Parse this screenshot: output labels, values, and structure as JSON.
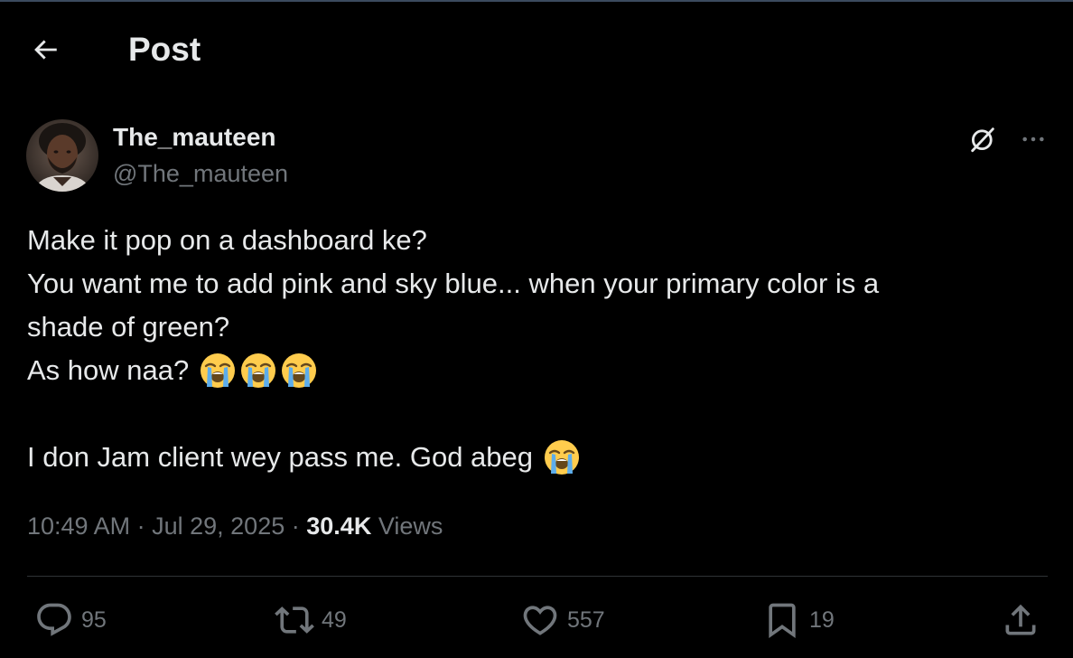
{
  "header": {
    "title": "Post",
    "back_icon": "arrow-left-icon"
  },
  "author": {
    "display_name": "The_mauteen",
    "handle": "@The_mauteen",
    "avatar": "avatar-photo"
  },
  "post": {
    "lines": [
      "Make it pop on a dashboard ke?",
      "You want me to add pink and sky blue... when your primary color is a",
      "shade of green?",
      "As how naa?",
      "",
      "I don Jam client wey pass me. God abeg"
    ],
    "emoji": "loudly-crying-face-emoji"
  },
  "meta": {
    "time": "10:49 AM",
    "separator": "·",
    "date": "Jul 29, 2025",
    "views_count": "30.4K",
    "views_label": "Views"
  },
  "actions": {
    "replies": "95",
    "reposts": "49",
    "likes": "557",
    "bookmarks": "19"
  },
  "colors": {
    "background": "#000000",
    "text_primary": "#e7e9ea",
    "text_secondary": "#71767b",
    "divider": "#2f3336"
  }
}
